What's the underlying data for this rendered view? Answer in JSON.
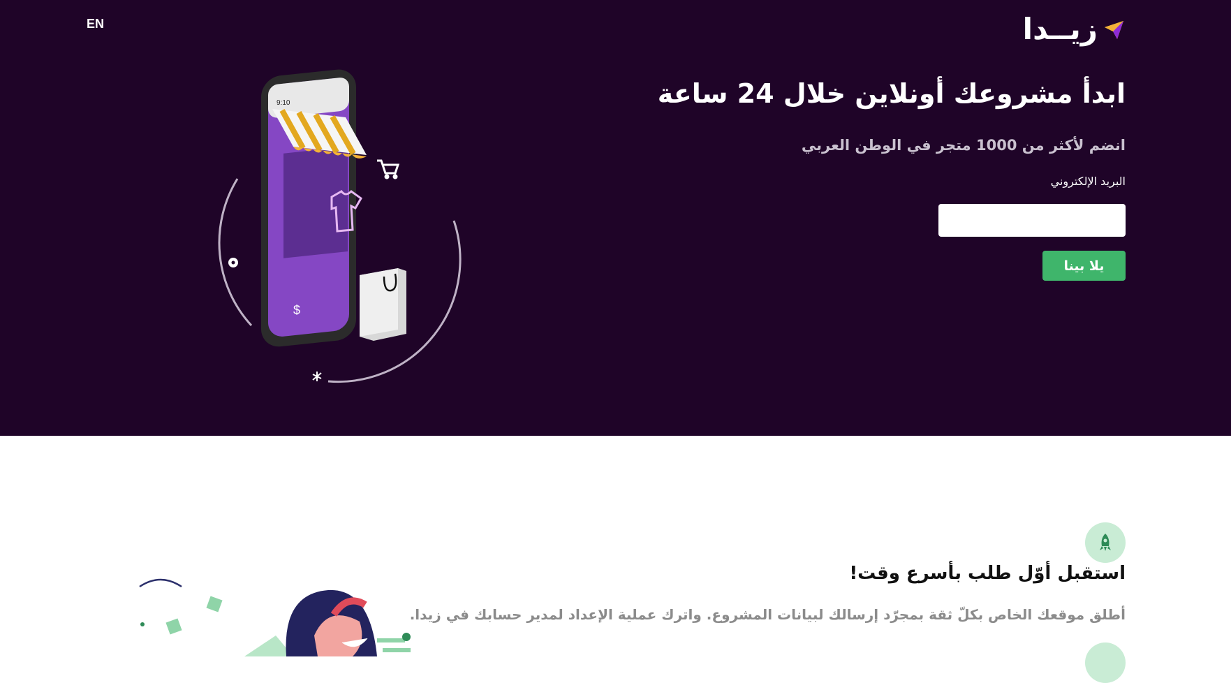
{
  "header": {
    "language_toggle": "EN",
    "logo_text": "زيــدا",
    "logo_icon": "paper-plane-logo"
  },
  "hero": {
    "title": "ابدأ مشروعك أونلاين خلال 24 ساعة",
    "subtitle": "انضم لأكثر من 1000 متجر في الوطن العربي",
    "email_label": "البريد الإلكتروني",
    "email_value": "",
    "cta_label": "يلا بينا",
    "phone_time": "9:10"
  },
  "feature": {
    "icon": "rocket-icon",
    "title": "استقبل أوّل طلب بأسرع وقت!",
    "description": "أطلق موقعك الخاص بكلّ ثقة بمجرّد إرسالك لبيانات المشروع. واترك عملية الإعداد لمدير حسابك في زيدا."
  },
  "colors": {
    "hero_bg": "#1f0428",
    "accent_green": "#3fb56b",
    "logo_purple": "#8e2bd6",
    "logo_yellow": "#f7c948",
    "icon_circle": "#c9ecd5"
  }
}
